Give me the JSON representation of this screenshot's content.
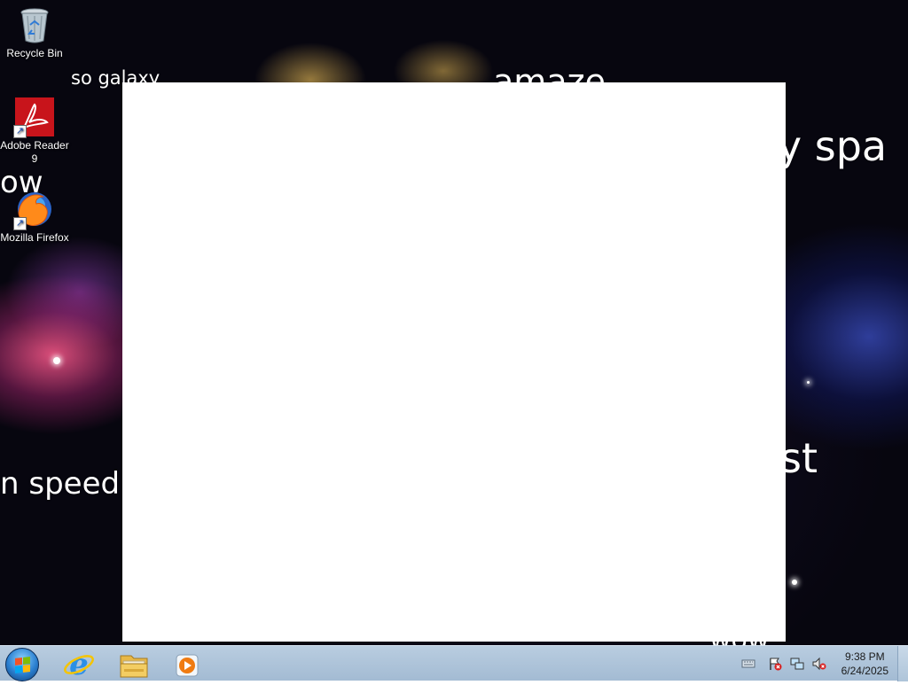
{
  "desktop": {
    "wallpaper_texts": [
      {
        "text": "so galaxy"
      },
      {
        "text": "amaze"
      },
      {
        "text": "ry spa"
      },
      {
        "text": "ow"
      },
      {
        "text": "n speed"
      },
      {
        "text": "st"
      },
      {
        "text": "wow"
      }
    ],
    "icons": [
      {
        "label": "Recycle Bin",
        "icon": "recycle-bin-icon"
      },
      {
        "label": "Adobe Reader 9",
        "icon": "adobe-reader-icon"
      },
      {
        "label": "Mozilla Firefox",
        "icon": "firefox-icon"
      }
    ]
  },
  "taskbar": {
    "pinned": [
      {
        "icon": "internet-explorer-icon"
      },
      {
        "icon": "file-explorer-icon"
      },
      {
        "icon": "media-player-icon"
      }
    ],
    "tray": [
      {
        "icon": "keyboard-icon"
      },
      {
        "icon": "action-center-flag-icon"
      },
      {
        "icon": "network-icon"
      },
      {
        "icon": "volume-muted-icon"
      }
    ],
    "clock": {
      "time": "9:38 PM",
      "date": "6/24/2025"
    }
  },
  "colors": {
    "taskbar": "#a3bbd3",
    "window": "#ffffff",
    "firefox_orange": "#ff8a1a",
    "adobe_red": "#c8141b"
  }
}
